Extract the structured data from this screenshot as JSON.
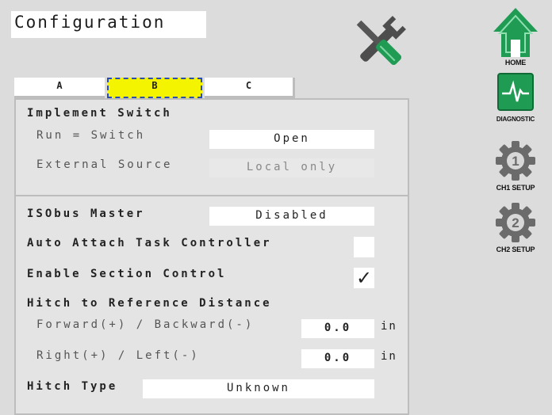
{
  "title": "Configuration",
  "tabs": [
    {
      "label": "A"
    },
    {
      "label": "B",
      "active": true
    },
    {
      "label": "C"
    }
  ],
  "implement_switch": {
    "heading": "Implement Switch",
    "run_switch_label": "Run = Switch",
    "run_switch_value": "Open",
    "external_source_label": "External Source",
    "external_source_value": "Local only"
  },
  "isobus_master": {
    "label": "ISObus Master",
    "value": "Disabled"
  },
  "auto_attach": {
    "label": "Auto Attach Task Controller",
    "checked": false
  },
  "section_control": {
    "label": "Enable Section Control",
    "checked": true,
    "check_glyph": "✓"
  },
  "hitch_distance": {
    "heading": "Hitch to Reference Distance",
    "forward_label": "Forward(+) / Backward(-)",
    "forward_value": "0.0",
    "right_label": "Right(+) / Left(-)",
    "right_value": "0.0",
    "unit": "in"
  },
  "hitch_type": {
    "label": "Hitch Type",
    "value": "Unknown"
  },
  "sidebar": {
    "home_label": "HOME",
    "diagnostic_label": "DIAGNOSTIC",
    "ch1_label": "CH1 SETUP",
    "ch1_number": "1",
    "ch2_label": "CH2 SETUP",
    "ch2_number": "2"
  },
  "colors": {
    "accent_green": "#1f9b54",
    "gear_gray": "#6b6b6b",
    "active_tab": "#f4f400"
  },
  "icons": [
    "tools-icon",
    "home-icon",
    "diagnostic-icon",
    "gear-1-icon",
    "gear-2-icon"
  ]
}
